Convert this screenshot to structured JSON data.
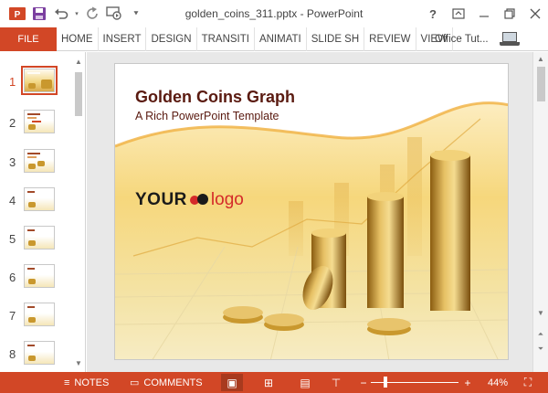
{
  "titlebar": {
    "title": "golden_coins_311.pptx - PowerPoint",
    "qat": [
      {
        "icon": "powerpoint-logo-icon"
      },
      {
        "icon": "save-icon"
      },
      {
        "icon": "undo-icon"
      },
      {
        "icon": "redo-icon"
      },
      {
        "icon": "present-from-start-icon"
      },
      {
        "icon": "customize-qat-icon"
      }
    ],
    "window_controls": [
      {
        "icon": "help-icon",
        "glyph": "?"
      },
      {
        "icon": "ribbon-display-options-icon",
        "glyph": "▣"
      },
      {
        "icon": "minimize-icon",
        "glyph": "—"
      },
      {
        "icon": "restore-icon",
        "glyph": "❐"
      },
      {
        "icon": "close-icon",
        "glyph": "✕"
      }
    ]
  },
  "ribbon": {
    "file_label": "FILE",
    "tabs": [
      "HOME",
      "INSERT",
      "DESIGN",
      "TRANSITI",
      "ANIMATI",
      "SLIDE SH",
      "REVIEW",
      "VIEW"
    ],
    "account_label": "Office Tut...",
    "accent": "#d24726"
  },
  "thumbnails": {
    "selected": 1,
    "slides": [
      {
        "number": "1"
      },
      {
        "number": "2"
      },
      {
        "number": "3"
      },
      {
        "number": "4"
      },
      {
        "number": "5"
      },
      {
        "number": "6"
      },
      {
        "number": "7"
      },
      {
        "number": "8"
      }
    ]
  },
  "slide": {
    "title": "Golden Coins Graph",
    "subtitle": "A Rich PowerPoint Template",
    "logo_your": "YOUR",
    "logo_text": "logo",
    "title_color": "#5a1a10",
    "logo_accent": "#d42a2a"
  },
  "statusbar": {
    "notes_label": "NOTES",
    "comments_label": "COMMENTS",
    "zoom_label": "44%",
    "zoom_percent": 44,
    "active_view": "normal"
  }
}
